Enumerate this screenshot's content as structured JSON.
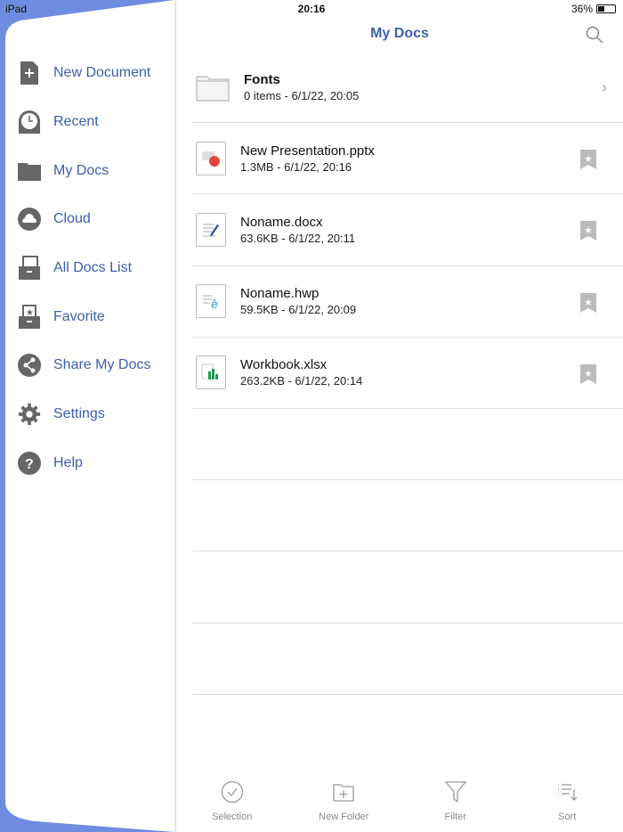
{
  "status": {
    "device": "iPad",
    "time": "20:16",
    "battery": "36%",
    "battery_level": 0.36
  },
  "sidebar": {
    "items": [
      {
        "label": "New Document",
        "icon": "new-document-icon"
      },
      {
        "label": "Recent",
        "icon": "clock-icon"
      },
      {
        "label": "My Docs",
        "icon": "folder-icon"
      },
      {
        "label": "Cloud",
        "icon": "cloud-icon"
      },
      {
        "label": "All Docs List",
        "icon": "all-docs-icon"
      },
      {
        "label": "Favorite",
        "icon": "favorite-icon"
      },
      {
        "label": "Share My Docs",
        "icon": "share-icon"
      },
      {
        "label": "Settings",
        "icon": "gear-icon"
      },
      {
        "label": "Help",
        "icon": "help-icon"
      }
    ]
  },
  "header": {
    "title": "My Docs"
  },
  "files": [
    {
      "name": "Fonts",
      "meta": "0 items - 6/1/22, 20:05",
      "type": "folder"
    },
    {
      "name": "New Presentation.pptx",
      "meta": "1.3MB - 6/1/22, 20:16",
      "type": "pptx"
    },
    {
      "name": "Noname.docx",
      "meta": "63.6KB - 6/1/22, 20:11",
      "type": "docx"
    },
    {
      "name": "Noname.hwp",
      "meta": "59.5KB - 6/1/22, 20:09",
      "type": "hwp"
    },
    {
      "name": "Workbook.xlsx",
      "meta": "263.2KB - 6/1/22, 20:14",
      "type": "xlsx"
    }
  ],
  "toolbar": {
    "selection": "Selection",
    "new_folder": "New Folder",
    "filter": "Filter",
    "sort": "Sort"
  },
  "colors": {
    "accent": "#3d5ea9",
    "sidebar_bg": "#6f8de0"
  }
}
